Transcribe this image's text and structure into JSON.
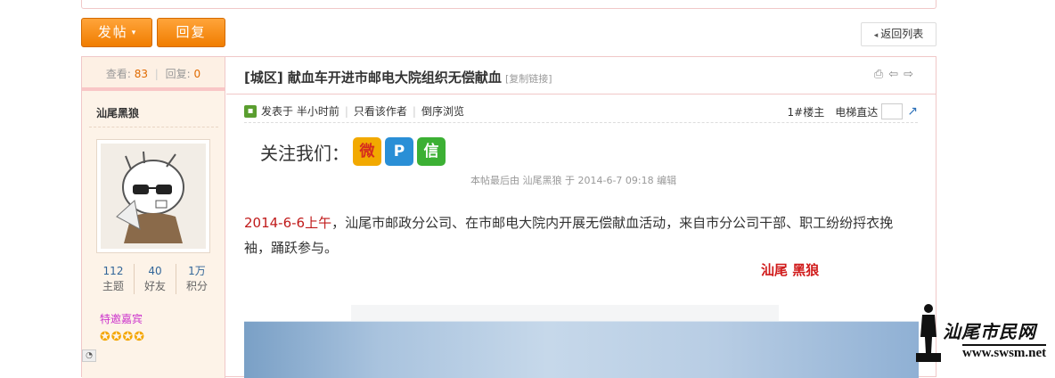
{
  "toolbar": {
    "post_label": "发帖",
    "post_caret": "▾",
    "reply_label": "回复",
    "back_label": "返回列表",
    "back_arrow": "◂"
  },
  "left": {
    "views_label": "查看:",
    "views": "83",
    "replies_label": "回复:",
    "replies": "0",
    "username": "汕尾黑狼",
    "stats": [
      {
        "value": "112",
        "label": "主题"
      },
      {
        "value": "40",
        "label": "好友"
      },
      {
        "value": "1万",
        "label": "积分"
      }
    ],
    "special_label": "特邀嘉宾",
    "stars": "✪✪✪✪"
  },
  "post": {
    "title": "[城区] 献血车开进市邮电大院组织无偿献血",
    "copy_link": "[复制链接]",
    "title_icons": "⎙⇦⇨",
    "published": "发表于 半小时前",
    "only_author": "只看该作者",
    "reverse": "倒序浏览",
    "floor": "1#楼主",
    "elevator": "电梯直达",
    "follow_label": "关注我们：",
    "social": [
      "微",
      "P",
      "信"
    ],
    "edit_note": "本帖最后由 汕尾黑狼 于 2014-6-7 09:18 编辑",
    "body_date": "2014-6-6上午",
    "body_rest": "，汕尾市邮政分公司、在市邮电大院内开展无偿献血活动，来自市分公司干部、职工纷纷捋衣挽袖，踊跃参与。",
    "signature": "汕尾 黑狼"
  },
  "watermark": {
    "text": "汕尾市民网",
    "url": "www.swsm.net"
  },
  "colors": {
    "accent_orange": "#f07d00",
    "border_pink": "#f0c8c8",
    "date_red": "#c01a1a"
  }
}
